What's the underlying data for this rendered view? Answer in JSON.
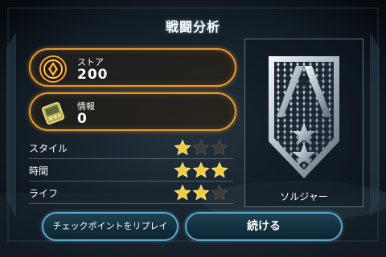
{
  "title": "戦闘分析",
  "store": {
    "label": "ストア",
    "value": "200",
    "icon": "cerberus-emblem-icon"
  },
  "intel": {
    "label": "情報",
    "value": "0",
    "icon": "intel-datapad-icon"
  },
  "ratings": [
    {
      "label": "スタイル",
      "stars": 1,
      "max": 3
    },
    {
      "label": "時間",
      "stars": 3,
      "max": 3
    },
    {
      "label": "ライフ",
      "stars": 2,
      "max": 3
    }
  ],
  "class_badge": {
    "caption": "ソルジャー",
    "icon": "soldier-class-insignia-icon"
  },
  "buttons": {
    "replay": "チェックポイントをリプレイ",
    "continue": "続ける"
  },
  "colors": {
    "accent_orange": "#e39a2c",
    "accent_cyan": "#5fa8c7",
    "star_gold": "#f2cc3a",
    "star_empty": "#3a3a3a"
  }
}
